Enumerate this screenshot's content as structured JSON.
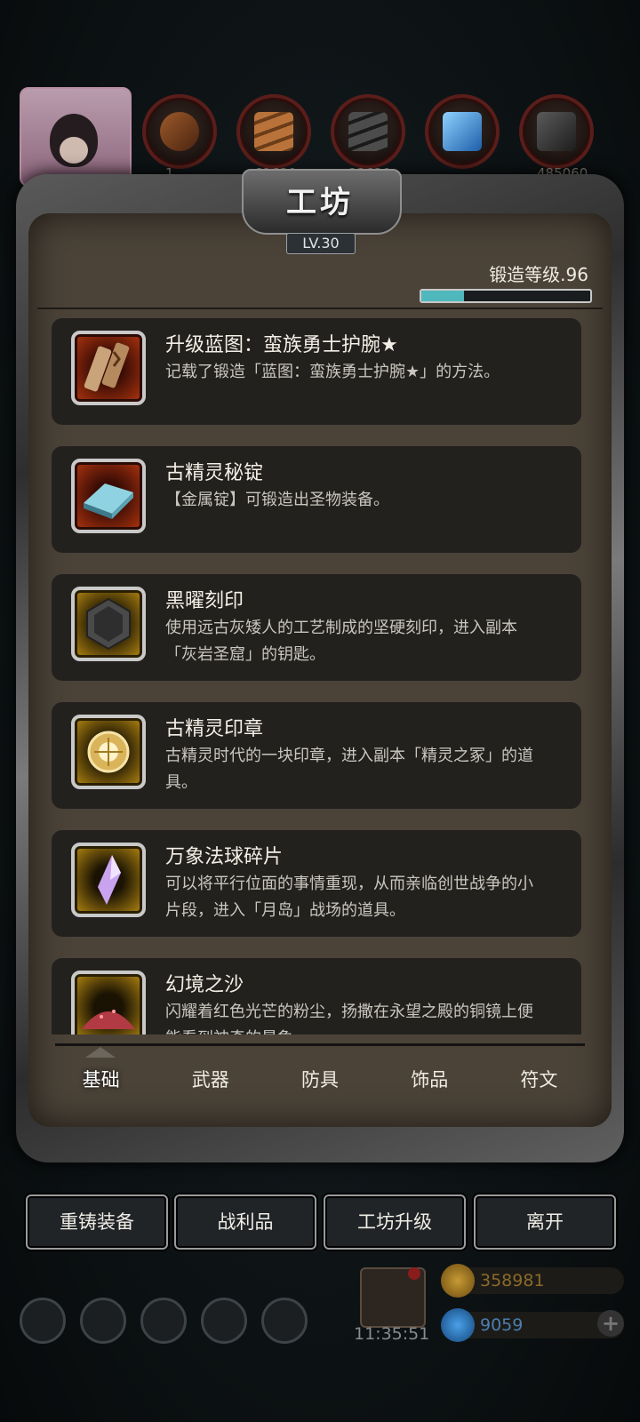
{
  "top_bar": {
    "resources": [
      {
        "icon": "wood-resource-icon",
        "value": "1"
      },
      {
        "icon": "plank-resource-icon",
        "value": "61620"
      },
      {
        "icon": "iron-resource-icon",
        "value": "23620"
      },
      {
        "icon": "crystal-resource-icon",
        "value": ""
      },
      {
        "icon": "ore-resource-icon",
        "value": "485060"
      }
    ]
  },
  "panel": {
    "title": "工坊",
    "level": "LV.30",
    "forge_level_label": "锻造等级.96",
    "forge_progress": 0.25
  },
  "items": [
    {
      "name": "升级蓝图：蛮族勇士护腕★",
      "desc": "记载了锻造「蓝图：蛮族勇士护腕★」的方法。",
      "icon": "blueprint-scroll-icon",
      "rarity": "red"
    },
    {
      "name": "古精灵秘锭",
      "desc": "【金属锭】可锻造出圣物装备。",
      "icon": "metal-ingot-icon",
      "rarity": "red"
    },
    {
      "name": "黑曜刻印",
      "desc": "使用远古灰矮人的工艺制成的坚硬刻印，进入副本「灰岩圣窟」的钥匙。",
      "icon": "obsidian-seal-icon",
      "rarity": "gold"
    },
    {
      "name": "古精灵印章",
      "desc": "古精灵时代的一块印章，进入副本「精灵之冢」的道具。",
      "icon": "elf-seal-icon",
      "rarity": "gold"
    },
    {
      "name": "万象法球碎片",
      "desc": "可以将平行位面的事情重现，从而亲临创世战争的小片段，进入「月岛」战场的道具。",
      "icon": "orb-shard-icon",
      "rarity": "gold"
    },
    {
      "name": "幻境之沙",
      "desc": "闪耀着红色光芒的粉尘，扬撒在永望之殿的铜镜上便能看到神奇的景象。",
      "icon": "red-sand-icon",
      "rarity": "gold"
    }
  ],
  "tabs": [
    "基础",
    "武器",
    "防具",
    "饰品",
    "符文"
  ],
  "active_tab": "基础",
  "buttons": {
    "reforge": "重铸装备",
    "loot": "战利品",
    "upgrade": "工坊升级",
    "leave": "离开"
  },
  "hud": {
    "clock": "11:35:51",
    "gold": "358981",
    "gems": "9059"
  },
  "colors": {
    "progress_fill": "#4fb8bd",
    "rarity_red": "#b1360f",
    "rarity_gold": "#b88a12"
  }
}
